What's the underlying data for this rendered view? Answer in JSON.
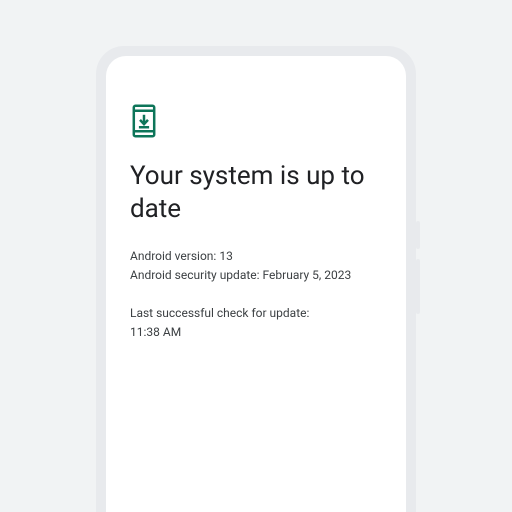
{
  "header": {
    "title": "Your system is up to date",
    "icon": "phone-download-icon",
    "icon_color": "#0d7559"
  },
  "details": {
    "version_label": "Android version:",
    "version_value": "13",
    "security_label": "Android security update:",
    "security_value": "February 5, 2023"
  },
  "last_check": {
    "label": "Last successful check for update:",
    "time": "11:38 AM"
  }
}
